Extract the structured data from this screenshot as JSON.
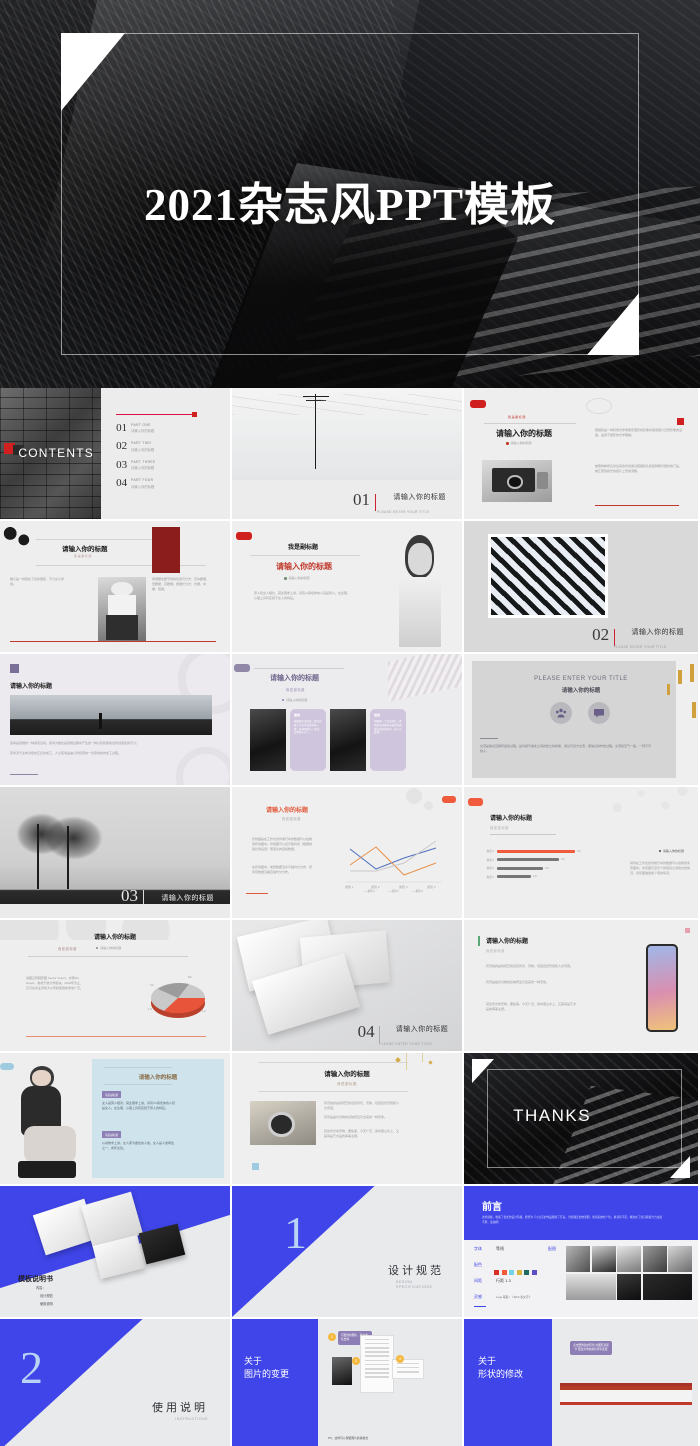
{
  "hero": {
    "title": "2021杂志风PPT模板",
    "theme": "dark-architecture-photo"
  },
  "slides": {
    "contents": {
      "label": "CONTENTS",
      "items": [
        {
          "num": "01",
          "en": "PART ONE",
          "cn": "请输入你的标题"
        },
        {
          "num": "02",
          "en": "PART TWO",
          "cn": "请输入你的标题"
        },
        {
          "num": "03",
          "en": "PART THREE",
          "cn": "请输入你的标题"
        },
        {
          "num": "04",
          "en": "PART FOUR",
          "cn": "请输入你的标题"
        }
      ]
    },
    "section01": {
      "num": "01",
      "cn": "请输入你的标题",
      "en": "PLEASE ENTER YOUR TITLE"
    },
    "section02": {
      "num": "02",
      "cn": "请输入你的标题",
      "en": "PLEASE ENTER YOUR TITLE"
    },
    "section03": {
      "num": "03",
      "cn": "请输入你的标题",
      "en": "PLEASE ENTER YOUR TITLE"
    },
    "section04": {
      "num": "04",
      "cn": "请输入你的标题",
      "en": "PLEASE ENTER YOUR TITLE"
    },
    "camera": {
      "sub": "我是副标题",
      "title": "请输入你的标题",
      "bullet": "请输入你的标题",
      "body1": "照相机是一种利用光学成像原理形成影像并使用底片记录影像的设备。是用于摄影的光学器械。",
      "body2": "被照物体所反射出来的光线通过照相镜头和控制曝光量的快门后，被汇聚到感光的底片上形成潜像。"
    },
    "fashion": {
      "title": "请输入你的标题",
      "sub": "我是副标题",
      "col1": "裙子是一种围在下身的服装，不分女子穿用。",
      "col2": "裙装是一种除了下身的服装，是females服装形式之一，广义的裙子包括连衣裙、衬裙、短裙、裙裤、腰裙。",
      "col3": "按裙腰在腰节线的位置可分为：高中腰裙、低腰裙、高腰裙。按裙长分为：长裙、中裙、短裙。"
    },
    "portrait": {
      "sub": "我是副标题",
      "title": "请输入你的标题",
      "bullet": "请输入你的标题",
      "body": "男人和女人相比，其生理学上讲，具有xy染色体的人就是男人。在生理、心理上具有区别于女人的特征。"
    },
    "thinking": {
      "title": "请输入你的标题",
      "body1": "思考是思维的一种探索活动，思考为推论是思维过程中产生的一种认知和能动性和创造性的可分。",
      "body2": "思考对于主体对象的正反的加工，人之思考是由心智和意向一位意向的的加工过程。"
    },
    "cards": {
      "title": "请输入你的标题",
      "sub": "我是副标题",
      "bullet": "请输入你的标题",
      "items": [
        {
          "label": "瑜伽",
          "text": "瑜伽源于古印度，是古印度六大哲学派系中的一种，探寻冥想与一生活，达到天人合一。"
        },
        {
          "label": "唱歌",
          "text": "唱歌是一个汉语词汇，意思是以抑扬有节奏的音调发出美妙的声音，动人以旋律。"
        }
      ]
    },
    "communication": {
      "en_title": "PLEASE ENTER YOUR TITLE",
      "cn_title": "请输入你的标题",
      "icons": [
        "people-icon",
        "chat-icon"
      ],
      "body": "交流是信息互相传递的过程，是沟通与彼此之间的建立的桥梁，通过与双方交流，使信息动作的过程。交流如空气一般，一刻不可缺少。"
    },
    "linechart": {
      "title": "请输入你的标题",
      "sub": "我是副标题",
      "body1": "折线图是在工作表的列或行中的数据可以绘制到折线图中。折线图可以显示随时间（根据常用比例设置）而变化的连续数据。",
      "body2": "在折线图中，类别数据沿水平轴均匀分布，所有值数据沿垂直轴均匀分布。"
    },
    "barchart": {
      "title": "请输入你的标题",
      "sub": "我是副标题",
      "legend": "请输入你的标题",
      "body": "排列在工作表的列或行中的数据可以绘制到条形图中。条形图可显示个别项目之间的比较情况，条形图描述各个项的情况。"
    },
    "piechart": {
      "title": "请输入你的标题",
      "sub": "我是副标题",
      "bullet": "请输入你的标题",
      "body": "饼图又称圆形图 Sector Graph，亦称Pie Graph。常用于统计学模块。2018年为止，它们在商业界和大众传媒使用的非常广泛。"
    },
    "ballet": {
      "title": "请输入你的标题",
      "tag1": "请是副标题",
      "tag2": "请是副标题",
      "body1": "女人是男人相对，其生理学上讲，具有XX染色体的人就是女人。在生理、心理上具有区别于男人的特征。",
      "body2": "从动物学上讲，女人即为雌性的人类。女人是人类两性之一，成年女性。"
    },
    "camera2": {
      "title": "请输入你的标题",
      "sub": "我是副标题",
      "body1": "风景指的是供观赏的自然风光、景物，包括自然景观和人文景观。",
      "body2": "风景是由光对物的反映所显示出来的一种景象。",
      "body3": "就这风光成景物，要些事，今天广泛，用中国山水上，又其间是艺术品的审美主题。"
    },
    "thanks": {
      "text": "THANKS"
    }
  },
  "manual": {
    "cover": {
      "title": "模板说明书",
      "label": "内容：",
      "items": [
        "设计规范",
        "使用说明"
      ]
    },
    "design_spec": {
      "num": "1",
      "cn": "设计规范",
      "en": "DESIGN SPECIFICATIONS"
    },
    "instructions": {
      "num": "2",
      "cn": "使用说明",
      "en": "INSTRUCTIONS"
    },
    "preface": {
      "title": "前言",
      "body": "这份模板，收集了各式的设计风格，希望为【小之花的作品能够了开来，为您确定的效果图，重新系统化个性，换汤存不足，精准在了您自我提升力这最不那，加油吧！",
      "rows": [
        {
          "key": "字体",
          "value": "等线"
        },
        {
          "key": "配色",
          "value": ""
        },
        {
          "key": "间距",
          "value": "行距 1.3"
        },
        {
          "key": "灵感",
          "value": "Logo 取取 / 《Web 客文字》"
        }
      ],
      "image_label": "配图",
      "swatches": [
        "#d93025",
        "#f05a3a",
        "#6fd4e8",
        "#d8b53c",
        "#1f6b63",
        "#5b4fc4"
      ]
    },
    "images_change": {
      "title_line1": "关于",
      "title_line2": "图片的变更",
      "callout": "可更换的图片，若点击队去除",
      "steps": [
        "1",
        "2",
        "3"
      ],
      "note": "PS：这样可以保留图片的版格式"
    },
    "shapes_change": {
      "title_line1": "关于",
      "title_line2": "形状的修改",
      "callout": "点击要修改的形状 在图形选项卡 更改为填充颜色等等变更"
    }
  },
  "colors": {
    "brand_blue": "#3f45e8",
    "accent_red": "#cf1f1f",
    "accent_orange": "#ef5b3c",
    "accent_purple": "#7a6f96",
    "dark": "#141517"
  },
  "chart_data": [
    {
      "type": "line",
      "title": "请输入你的标题",
      "categories": [
        "类别 1",
        "类别 2",
        "类别 3",
        "类别 4"
      ],
      "series": [
        {
          "name": "系列 1",
          "values": [
            4.3,
            2.5,
            3.5,
            4.5
          ]
        },
        {
          "name": "系列 2",
          "values": [
            2.4,
            4.4,
            1.8,
            2.8
          ]
        },
        {
          "name": "系列 3",
          "values": [
            2.0,
            2.0,
            3.0,
            5.0
          ]
        }
      ],
      "ylim": [
        0,
        6
      ],
      "grid": false,
      "legend": "bottom"
    },
    {
      "type": "bar",
      "title": "请输入你的标题",
      "orientation": "horizontal",
      "categories": [
        "类别 4",
        "类别 3",
        "类别 2",
        "类别 1"
      ],
      "values": [
        4.5,
        3.5,
        2.5,
        1.8
      ],
      "colors": [
        "#ef5b3c",
        "#767676",
        "#767676",
        "#767676"
      ],
      "legend": "请输入你的标题"
    },
    {
      "type": "pie",
      "title": "请输入你的标题",
      "labels": [
        "销售额 1",
        "销售额 2",
        "销售额 3",
        "销售额 4"
      ],
      "values": [
        8.2,
        3.2,
        1.4,
        1.2
      ],
      "colors": [
        "#e8543a",
        "#c9c9c9",
        "#a8a8a8",
        "#8e8e8e"
      ]
    }
  ]
}
